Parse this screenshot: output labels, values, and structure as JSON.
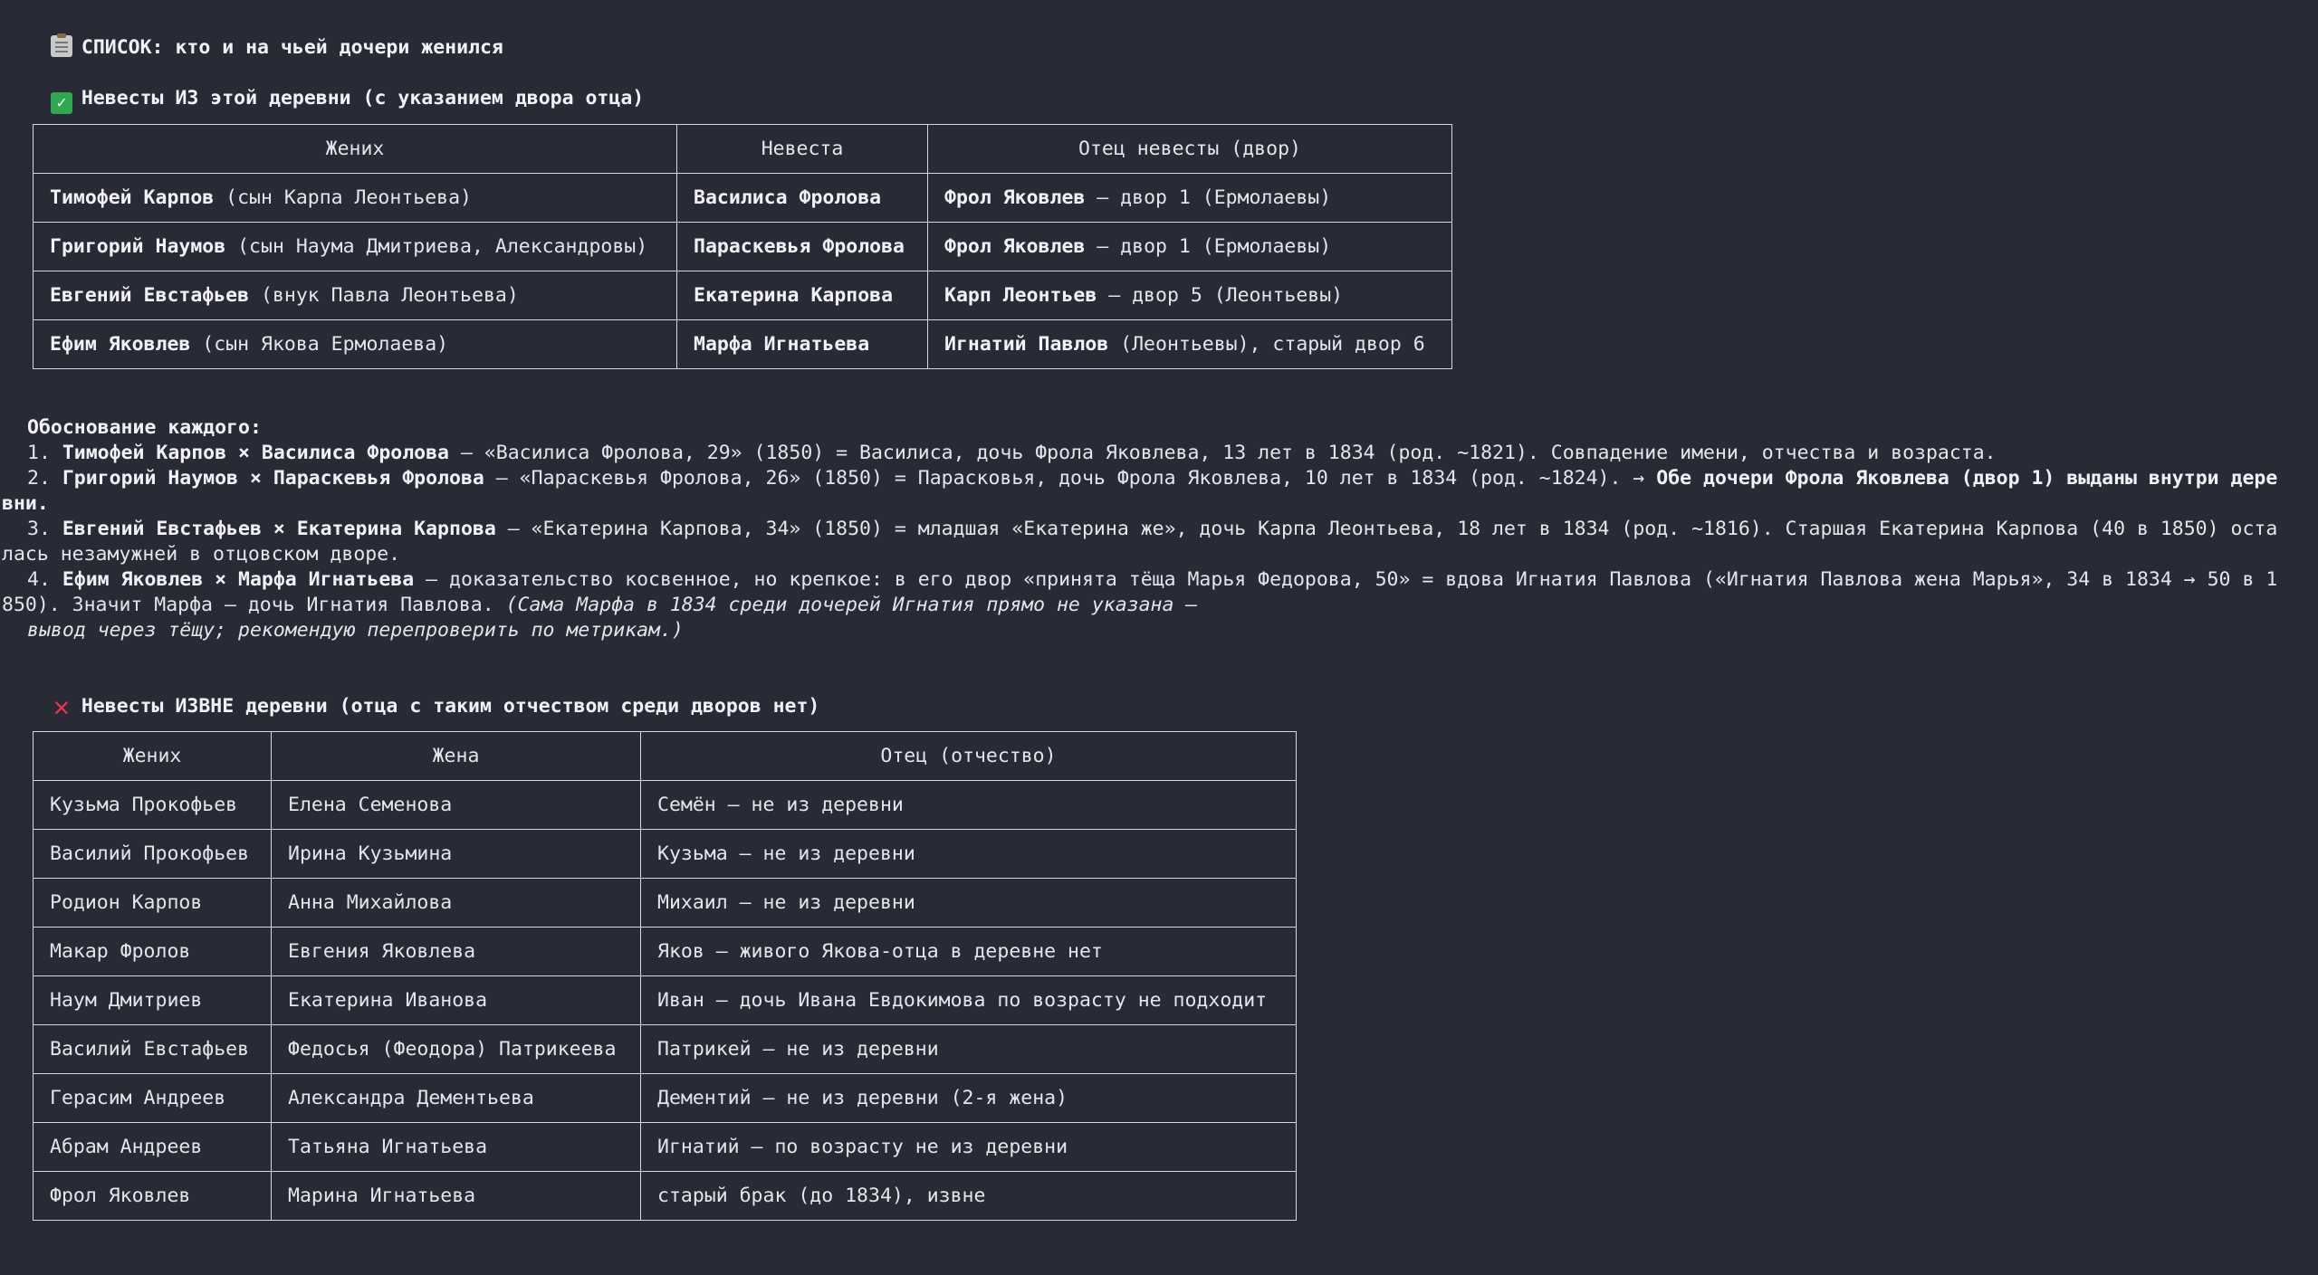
{
  "header": {
    "icon": "clipboard-icon",
    "title": "СПИСОК: кто и на чьей дочери женился"
  },
  "inside": {
    "icon": "check-mark-icon",
    "heading": "Невесты ИЗ этой деревни (с указанием двора отца)",
    "columns": [
      "Жених",
      "Невеста",
      "Отец невесты (двор)"
    ],
    "rows": [
      {
        "groom": "Тимофей Карпов",
        "groom_note": " (сын Карпа Леонтьева)",
        "bride": "Василиса Фролова",
        "father": "Фрол Яковлев",
        "father_note": " — двор 1 (Ермолаевы)"
      },
      {
        "groom": "Григорий Наумов",
        "groom_note": " (сын Наума Дмитриева, Александровы)",
        "bride": "Параскевья Фролова",
        "father": "Фрол Яковлев",
        "father_note": " — двор 1 (Ермолаевы)"
      },
      {
        "groom": "Евгений Евстафьев",
        "groom_note": " (внук Павла Леонтьева)",
        "bride": "Екатерина Карпова",
        "father": "Карп Леонтьев",
        "father_note": " — двор 5 (Леонтьевы)"
      },
      {
        "groom": "Ефим Яковлев",
        "groom_note": " (сын Якова Ермолаева)",
        "bride": "Марфа Игнатьева",
        "father": "Игнатий Павлов",
        "father_note": " (Леонтьевы), старый двор 6"
      }
    ]
  },
  "explanation": {
    "heading": "Обоснование каждого:",
    "items": [
      {
        "lines": [
          [
            {
              "t": "1. "
            },
            {
              "t": "Тимофей Карпов × Василиса Фролова",
              "b": true
            },
            {
              "t": " — «Василиса Фролова, 29» (1850) = Василиса, дочь Фрола Яковлева, 13 лет в 1834 (род. ~1821). Совпадение имени, отчества и возраста."
            }
          ]
        ]
      },
      {
        "lines": [
          [
            {
              "t": "2. "
            },
            {
              "t": "Григорий Наумов × Параскевья Фролова",
              "b": true
            },
            {
              "t": " — «Параскевья Фролова, 26» (1850) = Парасковья, дочь Фрола Яковлева, 10 лет в 1834 (род. ~1824). → "
            },
            {
              "t": "Обе дочери Фрола Яковлева (двор 1) выданы внутри дере",
              "b": true
            }
          ],
          [
            {
              "t": "вни.",
              "b": true
            }
          ]
        ]
      },
      {
        "lines": [
          [
            {
              "t": "3. "
            },
            {
              "t": "Евгений Евстафьев × Екатерина Карпова",
              "b": true
            },
            {
              "t": " — «Екатерина Карпова, 34» (1850) = младшая «Екатерина же», дочь Карпа Леонтьева, 18 лет в 1834 (род. ~1816). Старшая Екатерина Карпова (40 в 1850) оста"
            }
          ],
          [
            {
              "t": "лась незамужней в отцовском дворе."
            }
          ]
        ]
      },
      {
        "lines": [
          [
            {
              "t": "4. "
            },
            {
              "t": "Ефим Яковлев × Марфа Игнатьева",
              "b": true
            },
            {
              "t": " — доказательство косвенное, но крепкое: в его двор «принята тёща Марья Федорова, 50» = вдова Игнатия Павлова («Игнатия Павлова жена Марья», 34 в 1834 → 50 в 1"
            }
          ],
          [
            {
              "t": "850). Значит Марфа — дочь Игнатия Павлова. "
            },
            {
              "t": "(Сама Марфа в 1834 среди дочерей Игнатия прямо не указана —",
              "i": true
            }
          ],
          [
            {
              "t": "вывод через тёщу; рекомендую перепроверить по метрикам.)",
              "i": true
            }
          ]
        ]
      }
    ]
  },
  "outside": {
    "icon": "cross-mark-icon",
    "heading": "Невесты ИЗВНЕ деревни (отца с таким отчеством среди дворов нет)",
    "columns": [
      "Жених",
      "Жена",
      "Отец (отчество)"
    ],
    "rows": [
      [
        "Кузьма Прокофьев",
        "Елена Семенова",
        "Семён — не из деревни"
      ],
      [
        "Василий Прокофьев",
        "Ирина Кузьмина",
        "Кузьма — не из деревни"
      ],
      [
        "Родион Карпов",
        "Анна Михайлова",
        "Михаил — не из деревни"
      ],
      [
        "Макар Фролов",
        "Евгения Яковлева",
        "Яков — живого Якова-отца в деревне нет"
      ],
      [
        "Наум Дмитриев",
        "Екатерина Иванова",
        "Иван — дочь Ивана Евдокимова по возрасту не подходит"
      ],
      [
        "Василий Евстафьев",
        "Федосья (Феодора) Патрикеева",
        "Патрикей — не из деревни"
      ],
      [
        "Герасим Андреев",
        "Александра Дементьева",
        "Дементий — не из деревни (2-я жена)"
      ],
      [
        "Абрам Андреев",
        "Татьяна Игнатьева",
        "Игнатий — по возрасту не из деревни"
      ],
      [
        "Фрол Яковлев",
        "Марина Игнатьева",
        "старый брак (до 1834), извне"
      ]
    ]
  }
}
